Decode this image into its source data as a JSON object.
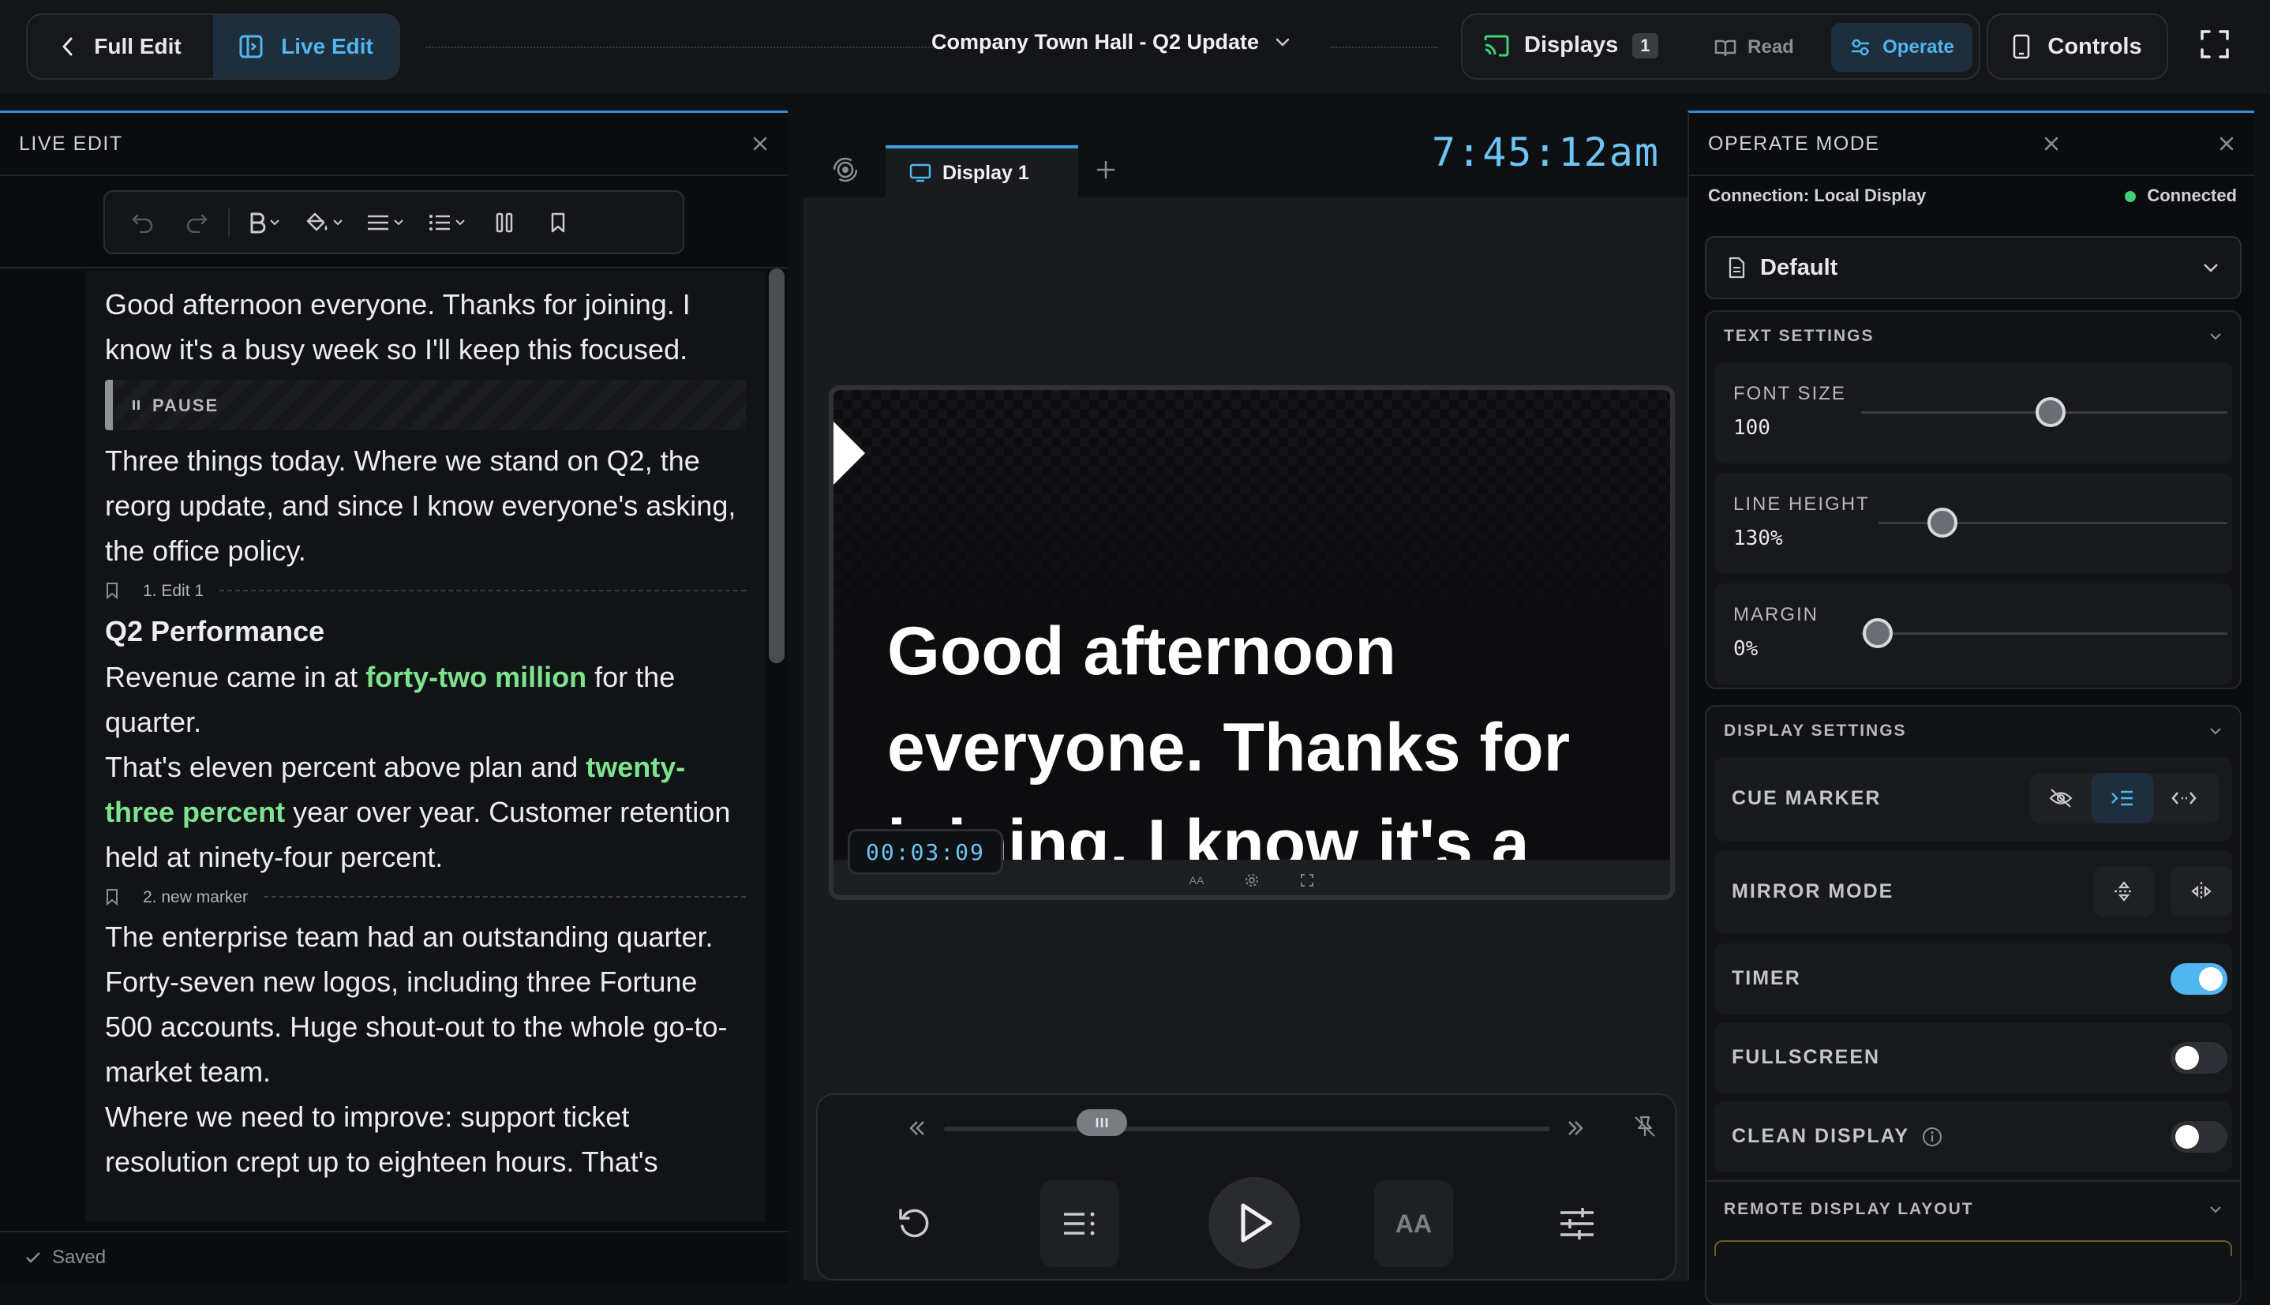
{
  "header": {
    "full_edit_label": "Full Edit",
    "live_edit_label": "Live Edit",
    "document_title": "Company Town Hall - Q2 Update",
    "displays_label": "Displays",
    "displays_count": "1",
    "read_label": "Read",
    "operate_label": "Operate",
    "controls_label": "Controls"
  },
  "live_edit": {
    "panel_title": "LIVE EDIT",
    "saved_label": "Saved",
    "script": {
      "p1": "Good afternoon everyone. Thanks for joining. I know it's a busy week so I'll keep this focused.",
      "pause_label": "PAUSE",
      "p2": "Three things today. Where we stand on Q2, the reorg update, and since I know everyone's asking, the office policy.",
      "marker1": "1. Edit 1",
      "heading": "Q2 Performance",
      "p3_a": "Revenue came in at ",
      "p3_hl": "forty-two million",
      "p3_b": " for the quarter.",
      "p4_a": "That's eleven percent above plan and ",
      "p4_hl": "twenty-three percent",
      "p4_b": " year over year. Customer retention held at ninety-four percent.",
      "marker2": "2. new marker",
      "p5": "The enterprise team had an outstanding quarter. Forty-seven new logos, including three Fortune 500 accounts. Huge shout-out to the whole go-to-market team.",
      "p6": "Where we need to improve: support ticket resolution crept up to eighteen hours. That's"
    }
  },
  "display": {
    "tab_label": "Display 1",
    "clock": "7:45:12am",
    "preview_text": "Good afternoon everyone. Thanks for joining. I know it's a",
    "elapsed_timer": "00:03:09",
    "small_aa_label": "AA",
    "font_button_label": "AA",
    "scrub_position_fraction": 0.26
  },
  "operate": {
    "panel_title": "OPERATE MODE",
    "connection_label": "Connection: Local Display",
    "connection_status": "Connected",
    "preset": "Default",
    "text_settings": {
      "title": "TEXT SETTINGS",
      "font_size_label": "FONT SIZE",
      "font_size_value": "100",
      "line_height_label": "LINE HEIGHT",
      "line_height_value": "130%",
      "margin_label": "MARGIN",
      "margin_value": "0%"
    },
    "display_settings": {
      "title": "DISPLAY SETTINGS",
      "cue_marker_label": "CUE MARKER",
      "mirror_mode_label": "MIRROR MODE",
      "timer_label": "TIMER",
      "timer_on": true,
      "fullscreen_label": "FULLSCREEN",
      "fullscreen_on": false,
      "clean_display_label": "CLEAN DISPLAY",
      "clean_display_on": false
    },
    "remote_layout_title": "REMOTE DISPLAY LAYOUT"
  },
  "colors": {
    "accent": "#4fb6f0",
    "highlight": "#7de38f",
    "connected": "#3fd07a"
  }
}
